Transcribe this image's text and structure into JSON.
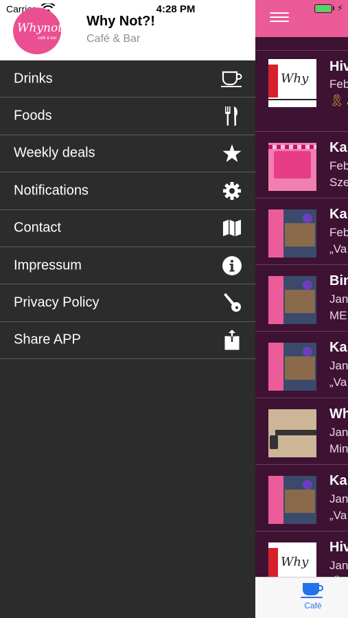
{
  "status_bar": {
    "carrier": "Carrier",
    "time": "4:28 PM"
  },
  "drawer": {
    "logo_text": "Whynot",
    "logo_tagline": "café & bar",
    "title": "Why Not?!",
    "subtitle": "Café & Bar",
    "menu": [
      {
        "label": "Drinks",
        "icon": "coffee-cup-icon"
      },
      {
        "label": "Foods",
        "icon": "fork-knife-icon"
      },
      {
        "label": "Weekly deals",
        "icon": "star-icon"
      },
      {
        "label": "Notifications",
        "icon": "gear-icon"
      },
      {
        "label": "Contact",
        "icon": "map-icon"
      },
      {
        "label": "Impressum",
        "icon": "info-icon"
      },
      {
        "label": "Privacy Policy",
        "icon": "key-icon"
      },
      {
        "label": "Share APP",
        "icon": "share-icon"
      }
    ]
  },
  "feed": {
    "items": [
      {
        "title": "Hiv",
        "date": "Feb",
        "desc": "🎗 A",
        "thumb": "logo"
      },
      {
        "title": "Kar",
        "date": "Feb",
        "desc": "Sze",
        "thumb": "karaoke"
      },
      {
        "title": "Kar",
        "date": "Feb",
        "desc": "„Va",
        "thumb": "bar"
      },
      {
        "title": "Bin",
        "date": "Jan",
        "desc": "MEI",
        "thumb": "bar"
      },
      {
        "title": "Kar",
        "date": "Jan",
        "desc": "„Va",
        "thumb": "bar"
      },
      {
        "title": "Wh",
        "date": "Jan",
        "desc": "Min",
        "thumb": "poster"
      },
      {
        "title": "Kar",
        "date": "Jan",
        "desc": "„Va",
        "thumb": "bar"
      },
      {
        "title": "Hiv",
        "date": "Jan",
        "desc": "🎗 A",
        "thumb": "logo"
      }
    ]
  },
  "tabbar": {
    "active_label": "Café"
  },
  "colors": {
    "accent_pink": "#ea5b97",
    "drawer_bg": "#2c2c2c",
    "feed_bg": "#3d1233",
    "tab_active": "#2373e8"
  }
}
